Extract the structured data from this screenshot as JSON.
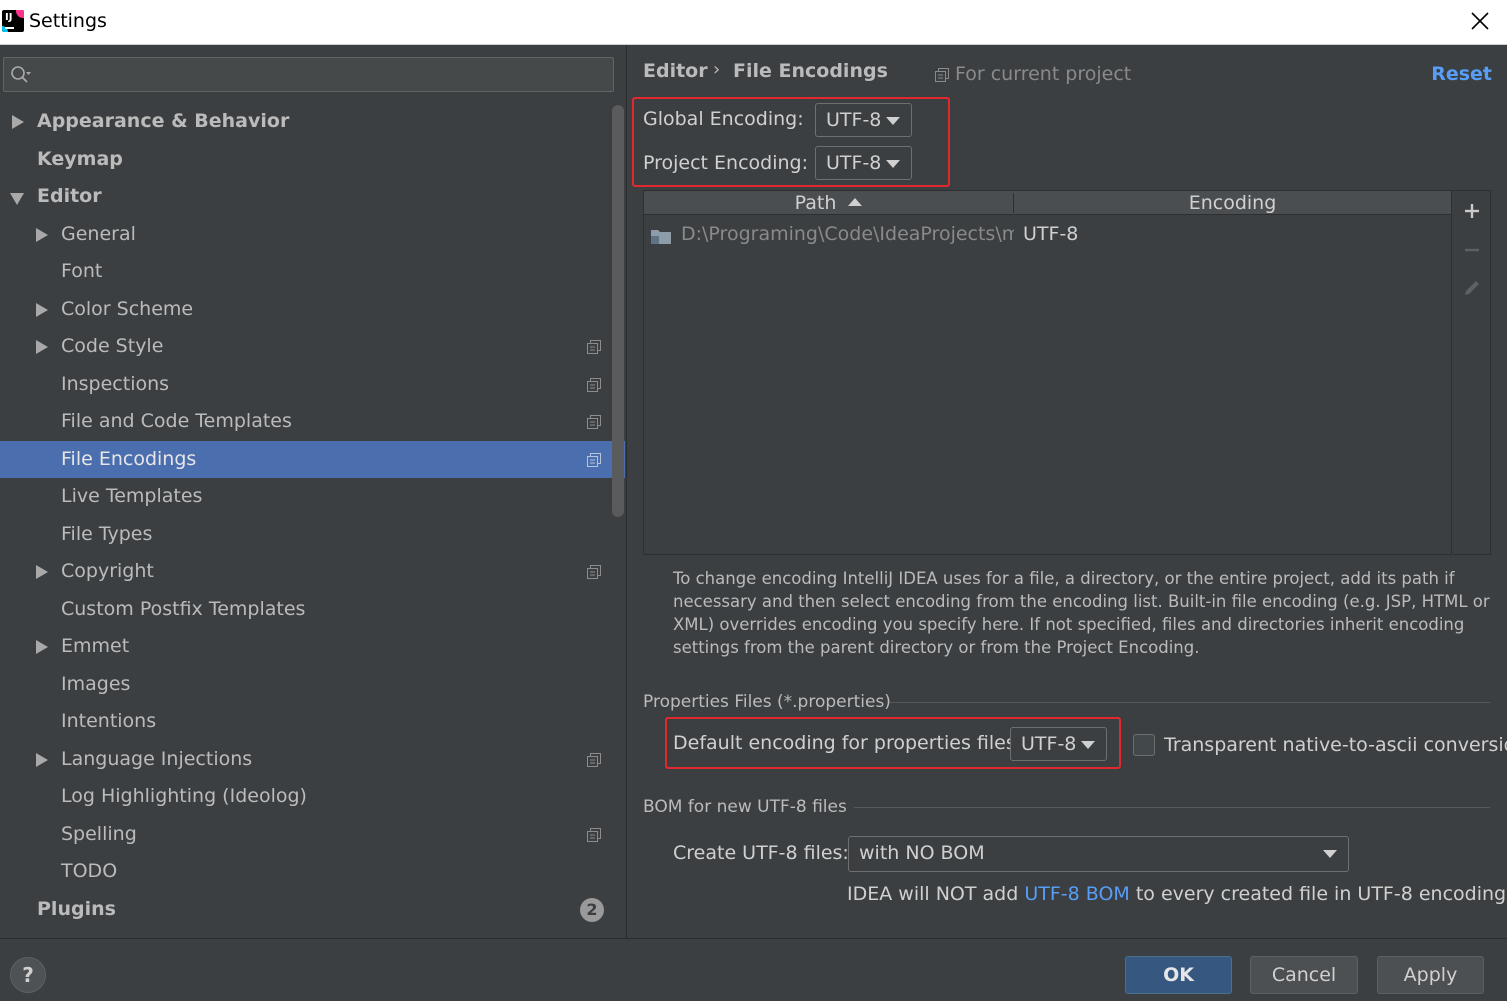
{
  "window": {
    "title": "Settings"
  },
  "search": {
    "placeholder": ""
  },
  "sidebar": {
    "items": [
      {
        "label": "Appearance & Behavior"
      },
      {
        "label": "Keymap"
      },
      {
        "label": "Editor"
      },
      {
        "label": "General"
      },
      {
        "label": "Font"
      },
      {
        "label": "Color Scheme"
      },
      {
        "label": "Code Style"
      },
      {
        "label": "Inspections"
      },
      {
        "label": "File and Code Templates"
      },
      {
        "label": "File Encodings"
      },
      {
        "label": "Live Templates"
      },
      {
        "label": "File Types"
      },
      {
        "label": "Copyright"
      },
      {
        "label": "Custom Postfix Templates"
      },
      {
        "label": "Emmet"
      },
      {
        "label": "Images"
      },
      {
        "label": "Intentions"
      },
      {
        "label": "Language Injections"
      },
      {
        "label": "Log Highlighting (Ideolog)"
      },
      {
        "label": "Spelling"
      },
      {
        "label": "TODO"
      },
      {
        "label": "Plugins"
      }
    ],
    "selected": "File Encodings",
    "plugins_badge": "2"
  },
  "breadcrumb": {
    "parent": "Editor",
    "separator": "›",
    "current": "File Encodings"
  },
  "scope": {
    "label": "For current project"
  },
  "reset": {
    "label": "Reset"
  },
  "encodings": {
    "global_label": "Global Encoding:",
    "global_value": "UTF-8",
    "project_label": "Project Encoding:",
    "project_value": "UTF-8"
  },
  "table": {
    "columns": [
      "Path",
      "Encoding"
    ],
    "rows": [
      {
        "path": "D:\\Programing\\Code\\IdeaProjects\\moc",
        "encoding": "UTF-8"
      }
    ]
  },
  "help_text": "To change encoding IntelliJ IDEA uses for a file, a directory, or the entire project, add its path if necessary and then select encoding from the encoding list. Built-in file encoding (e.g. JSP, HTML or XML) overrides encoding you specify here. If not specified, files and directories inherit encoding settings from the parent directory or from the Project Encoding.",
  "properties": {
    "section_title": "Properties Files (*.properties)",
    "default_label": "Default encoding for properties files:",
    "default_value": "UTF-8",
    "transparent_label": "Transparent native-to-ascii conversion",
    "transparent_checked": false
  },
  "bom": {
    "section_title": "BOM for new UTF-8 files",
    "create_label": "Create UTF-8 files:",
    "create_value": "with NO BOM",
    "note_before": "IDEA will NOT add ",
    "note_link": "UTF-8 BOM",
    "note_after": " to every created file in UTF-8 encoding"
  },
  "footer": {
    "help": "?",
    "ok": "OK",
    "cancel": "Cancel",
    "apply": "Apply"
  },
  "colors": {
    "background": "#3c3f41",
    "selection": "#4b6eaf",
    "link": "#589df6",
    "highlight_box": "#e0282e",
    "primary_button": "#365880"
  }
}
